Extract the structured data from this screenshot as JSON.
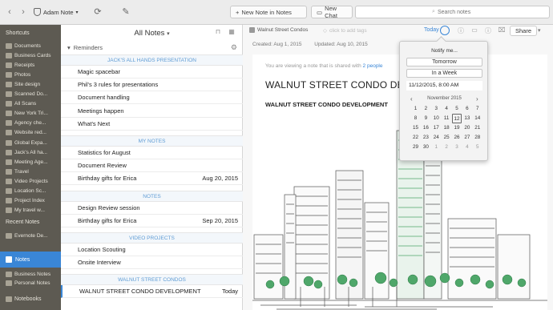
{
  "toolbar": {
    "back_icon": "chevron-left",
    "forward_icon": "chevron-right",
    "account_name": "Adam Note",
    "new_note_label": "New Note in Notes",
    "new_chat_label": "New Chat",
    "search_placeholder": "Search notes"
  },
  "sidebar": {
    "shortcuts_heading": "Shortcuts",
    "shortcuts": [
      "Documents",
      "Business Cards",
      "Receipts",
      "Photos",
      "Site design",
      "Scanned Do...",
      "All Scans",
      "New York Tri...",
      "Agency che...",
      "Website red...",
      "Global Expa...",
      "Jack's All ha...",
      "Meeting Age...",
      "Travel",
      "Video Projects",
      "Location Sc...",
      "Project Index",
      "My travel w..."
    ],
    "recent_heading": "Recent Notes",
    "recent": [
      "Evernote De..."
    ],
    "notes_label": "Notes",
    "notebooks": [
      "Business Notes",
      "Personal Notes"
    ],
    "notebooks_heading": "Notebooks"
  },
  "notelist": {
    "title": "All Notes",
    "reminders_label": "Reminders",
    "groups": [
      {
        "header": "JACK'S ALL HANDS PRESENTATION",
        "rows": [
          {
            "title": "Magic spacebar",
            "date": ""
          },
          {
            "title": "Phil's 3 rules for presentations",
            "date": ""
          },
          {
            "title": "Document handling",
            "date": ""
          },
          {
            "title": "Meetings happen",
            "date": ""
          },
          {
            "title": "What's Next",
            "date": ""
          }
        ]
      },
      {
        "header": "MY NOTES",
        "rows": [
          {
            "title": "Statistics for August",
            "date": ""
          },
          {
            "title": "Document Review",
            "date": ""
          },
          {
            "title": "Birthday gifts for Erica",
            "date": "Aug 20, 2015"
          }
        ]
      },
      {
        "header": "NOTES",
        "rows": [
          {
            "title": "Design Review session",
            "date": ""
          },
          {
            "title": "Birthday gifts for Erica",
            "date": "Sep 20, 2015"
          }
        ]
      },
      {
        "header": "VIDEO PROJECTS",
        "rows": [
          {
            "title": "Location Scouting",
            "date": ""
          },
          {
            "title": "Onsite Interview",
            "date": ""
          }
        ]
      },
      {
        "header": "WALNUT STREET CONDOS",
        "rows": [
          {
            "title": "WALNUT STREET CONDO DEVELOPMENT",
            "date": "Today"
          }
        ]
      }
    ]
  },
  "editor": {
    "notebook": "Walnut Street Condos",
    "tag_placeholder": "click to add tags",
    "today_label": "Today",
    "share_label": "Share",
    "created": "Created: Aug 1, 2015",
    "updated": "Updated: Aug 10, 2015",
    "shared_prefix": "You are viewing a note that is shared with",
    "shared_link": "2 people",
    "note_title": "WALNUT STREET CONDO DEVELO",
    "note_subtitle": "WALNUT STREET CONDO DEVELOPMENT"
  },
  "reminder_popup": {
    "notify_label": "Notify me...",
    "tomorrow": "Tomorrow",
    "in_a_week": "In a Week",
    "datetime": "11/12/2015,  8:00 AM",
    "month": "November 2015",
    "weeks": [
      [
        "1",
        "2",
        "3",
        "4",
        "5",
        "6",
        "7"
      ],
      [
        "8",
        "9",
        "10",
        "11",
        "12",
        "13",
        "14"
      ],
      [
        "15",
        "16",
        "17",
        "18",
        "19",
        "20",
        "21"
      ],
      [
        "22",
        "23",
        "24",
        "25",
        "26",
        "27",
        "28"
      ],
      [
        "29",
        "30",
        "1",
        "2",
        "3",
        "4",
        "5"
      ]
    ],
    "selected_day": "12"
  },
  "colors": {
    "accent": "#3a86d6",
    "sidebar_bg": "#5d5a52",
    "group_header_text": "#5e9bd4",
    "tree_green": "#4fa76a"
  }
}
